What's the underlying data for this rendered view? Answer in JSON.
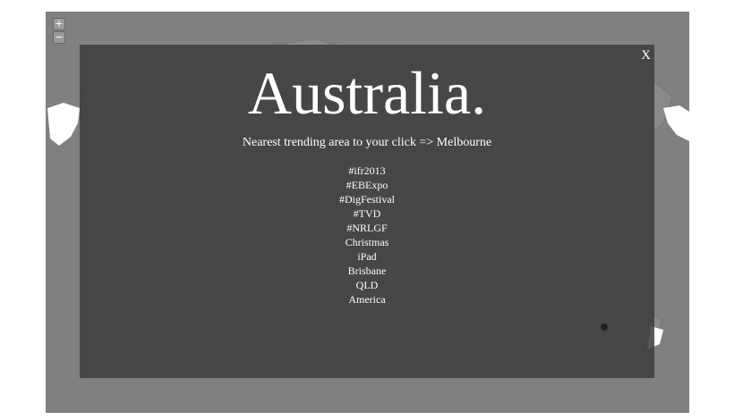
{
  "map": {
    "zoom_in_label": "+",
    "zoom_out_label": "−",
    "land_color": "#8a8a8a",
    "land_border_color": "#6e6e6e",
    "highlight_land_color": "#ffffff",
    "background_color": "#808080"
  },
  "overlay": {
    "close_label": "X",
    "country_title": "Australia.",
    "nearest_text": "Nearest trending area to your click => Melbourne",
    "trends": [
      "#ifr2013",
      "#EBExpo",
      "#DigFestival",
      "#TVD",
      "#NRLGF",
      "Christmas",
      "iPad",
      "Brisbane",
      "QLD",
      "America"
    ],
    "marker_color": "#222222"
  }
}
